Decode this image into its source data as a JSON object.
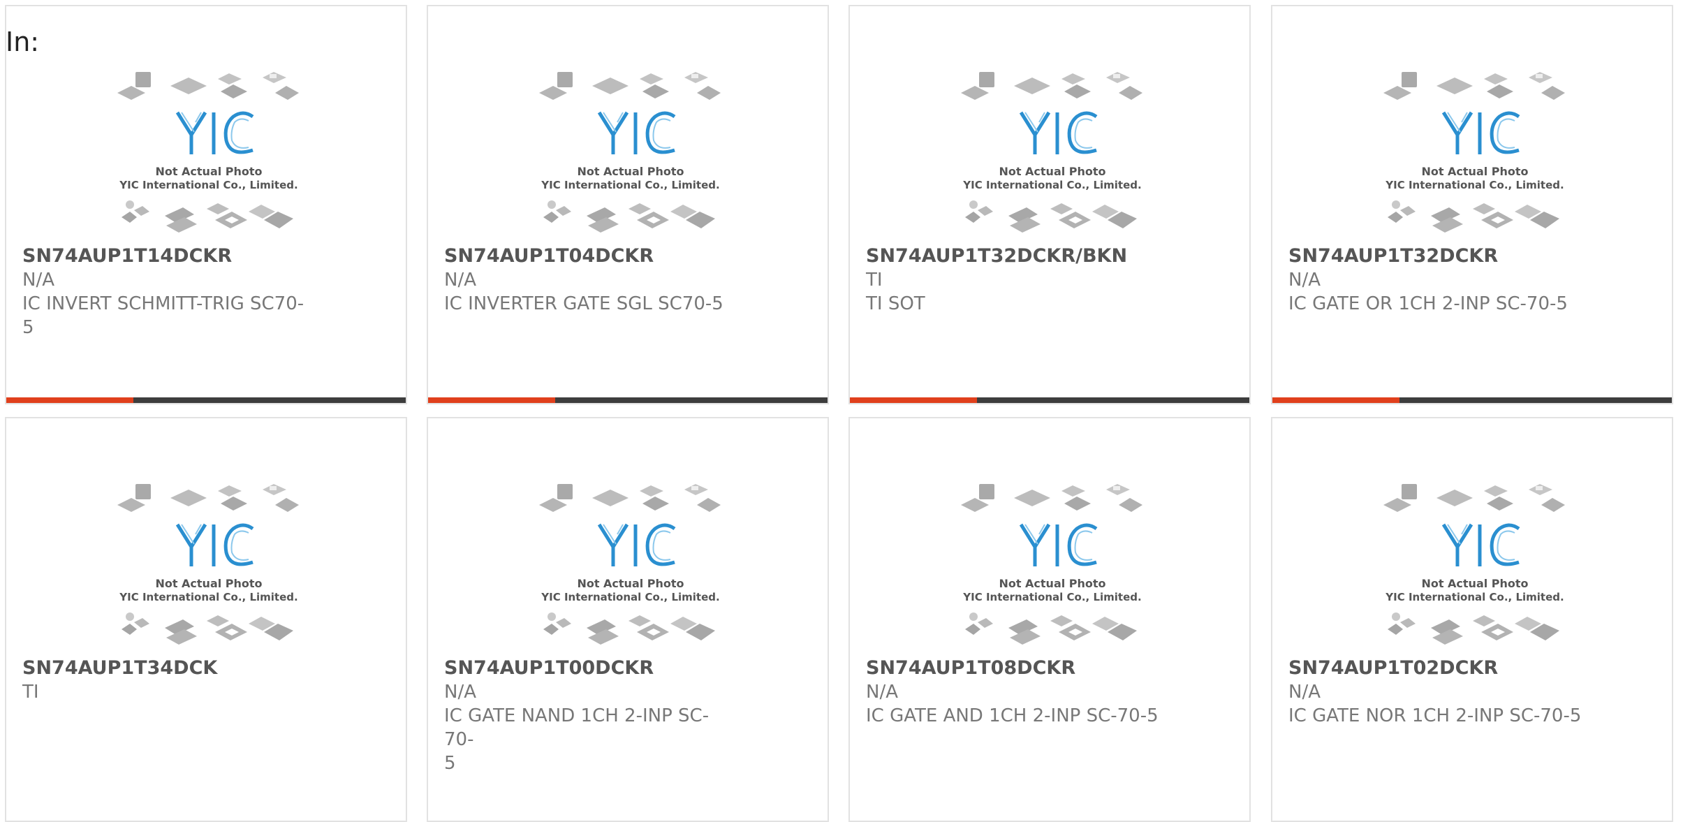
{
  "page": {
    "in_label": "In:"
  },
  "photo": {
    "line1": "Not Actual Photo",
    "line2": "YIC International Co., Limited.",
    "logo_text": "YIC"
  },
  "products": [
    {
      "part": "SN74AUP1T14DCKR",
      "mfr": "N/A",
      "desc": "IC INVERT SCHMITT-TRIG SC70-\n5"
    },
    {
      "part": "SN74AUP1T04DCKR",
      "mfr": "N/A",
      "desc": "IC INVERTER GATE SGL SC70-5"
    },
    {
      "part": "SN74AUP1T32DCKR/BKN",
      "mfr": "TI",
      "desc": "TI SOT"
    },
    {
      "part": "SN74AUP1T32DCKR",
      "mfr": "N/A",
      "desc": "IC GATE OR 1CH 2-INP SC-70-5"
    },
    {
      "part": "SN74AUP1T34DCK",
      "mfr": "TI",
      "desc": ""
    },
    {
      "part": "SN74AUP1T00DCKR",
      "mfr": "N/A",
      "desc": "IC GATE NAND 1CH 2-INP SC-70-\n5"
    },
    {
      "part": "SN74AUP1T08DCKR",
      "mfr": "N/A",
      "desc": "IC GATE AND 1CH 2-INP SC-70-5"
    },
    {
      "part": "SN74AUP1T02DCKR",
      "mfr": "N/A",
      "desc": "IC GATE NOR 1CH 2-INP SC-70-5"
    }
  ],
  "colors": {
    "accent": "#e0401c",
    "bar": "#3d3d3d",
    "logo": "#2a8fd0"
  }
}
